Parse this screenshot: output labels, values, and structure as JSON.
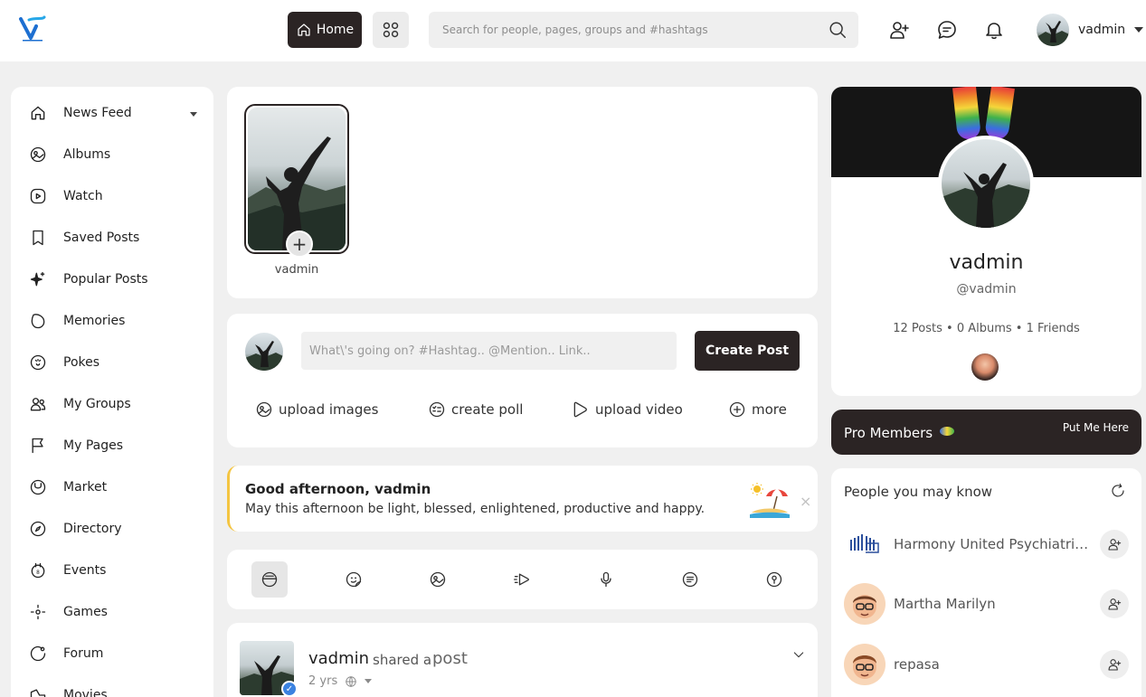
{
  "header": {
    "home_label": "Home",
    "search_placeholder": "Search for people, pages, groups and #hashtags",
    "username": "vadmin"
  },
  "sidebar": {
    "items": [
      {
        "label": "News Feed",
        "icon": "home-icon"
      },
      {
        "label": "Albums",
        "icon": "album-icon"
      },
      {
        "label": "Watch",
        "icon": "watch-icon"
      },
      {
        "label": "Saved Posts",
        "icon": "bookmark-icon"
      },
      {
        "label": "Popular Posts",
        "icon": "sparkle-icon"
      },
      {
        "label": "Memories",
        "icon": "memories-icon"
      },
      {
        "label": "Pokes",
        "icon": "poke-icon"
      },
      {
        "label": "My Groups",
        "icon": "groups-icon"
      },
      {
        "label": "My Pages",
        "icon": "flag-icon"
      },
      {
        "label": "Market",
        "icon": "market-icon"
      },
      {
        "label": "Directory",
        "icon": "compass-icon"
      },
      {
        "label": "Events",
        "icon": "calendar-icon"
      },
      {
        "label": "Games",
        "icon": "games-icon"
      },
      {
        "label": "Forum",
        "icon": "forum-icon"
      },
      {
        "label": "Movies",
        "icon": "movies-icon"
      }
    ]
  },
  "story": {
    "name": "vadmin",
    "add_symbol": "+"
  },
  "composer": {
    "placeholder": "What\\'s going on? #Hashtag.. @Mention.. Link..",
    "create_label": "Create Post",
    "actions": [
      {
        "label": "upload images",
        "icon": "image-icon"
      },
      {
        "label": "create poll",
        "icon": "poll-icon"
      },
      {
        "label": "upload video",
        "icon": "video-icon"
      },
      {
        "label": "more",
        "icon": "plus-circle-icon"
      }
    ]
  },
  "greeting": {
    "title": "Good afternoon, vadmin",
    "text": "May this afternoon be light, blessed, enlightened, productive and happy.",
    "close": "×"
  },
  "feed": {
    "name": "vadmin",
    "shared": "shared a",
    "post": "post",
    "time": "2 yrs"
  },
  "profile": {
    "name": "vadmin",
    "handle": "@vadmin",
    "stats": "12 Posts • 0 Albums • 1 Friends"
  },
  "pro": {
    "title": "Pro Members",
    "link": "Put Me Here"
  },
  "pymk": {
    "title": "People you may know",
    "people": [
      {
        "name": "Harmony United Psychiatric ..."
      },
      {
        "name": "Martha Marilyn"
      },
      {
        "name": "repasa"
      }
    ]
  },
  "colors": {
    "dark": "#2b2424",
    "accent_yellow": "#f4c542",
    "verified_blue": "#3b82e0"
  }
}
